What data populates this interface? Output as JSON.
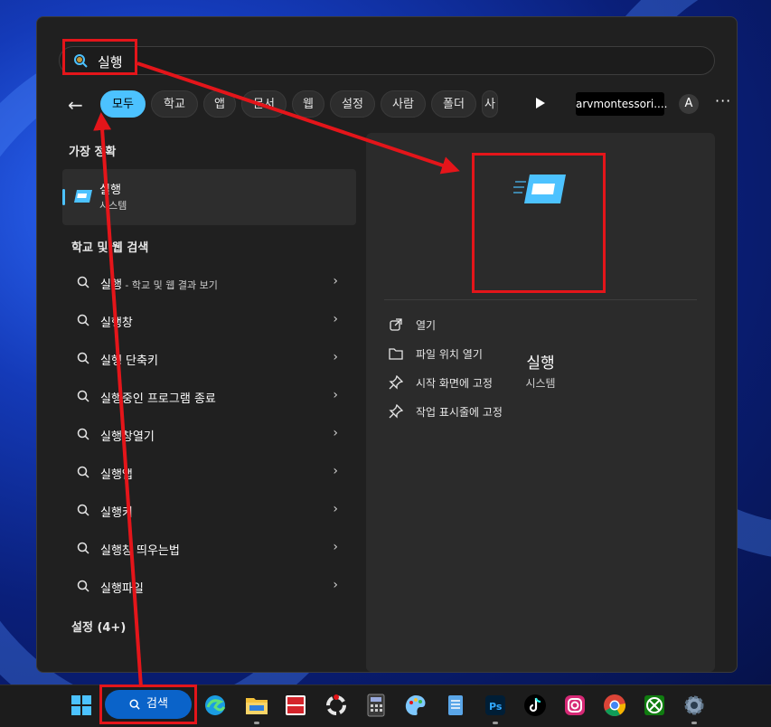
{
  "search": {
    "query": "실행"
  },
  "filters": {
    "back": "←",
    "chips": [
      "모두",
      "학교",
      "앱",
      "문서",
      "웹",
      "설정",
      "사람",
      "폴더",
      "사"
    ],
    "account": "arvmontessori....",
    "avatar": "A",
    "more": "···"
  },
  "best_match": {
    "heading": "가장 정확",
    "title": "실행",
    "subtitle": "시스템"
  },
  "web_search": {
    "heading": "학교 및 웹 검색",
    "first": {
      "query": "실행",
      "suffix": " - 학교 및 웹 결과 보기"
    },
    "items": [
      "실행창",
      "실행 단축키",
      "실행중인 프로그램 종료",
      "실행창열기",
      "실행앱",
      "실행키",
      "실행창 띄우는법",
      "실행파일"
    ]
  },
  "settings_heading": "설정 (4+)",
  "detail": {
    "title": "실행",
    "subtitle": "시스템",
    "actions": [
      {
        "icon": "open-external-icon",
        "label": "열기"
      },
      {
        "icon": "folder-icon",
        "label": "파일 위치 열기"
      },
      {
        "icon": "pin-icon",
        "label": "시작 화면에 고정"
      },
      {
        "icon": "pin-icon",
        "label": "작업 표시줄에 고정"
      }
    ]
  },
  "taskbar": {
    "search_label": "검색",
    "apps": [
      "windows-start-icon",
      "edge-icon",
      "file-explorer-icon",
      "app-red-icon",
      "app-ring-icon",
      "calculator-icon",
      "paint-icon",
      "notepad-icon",
      "photoshop-icon",
      "tiktok-icon",
      "instagram-icon",
      "chrome-icon",
      "xbox-icon",
      "settings-icon"
    ]
  },
  "colors": {
    "accent": "#4cc2ff",
    "annotation": "#e4151a",
    "panel": "#202020"
  }
}
